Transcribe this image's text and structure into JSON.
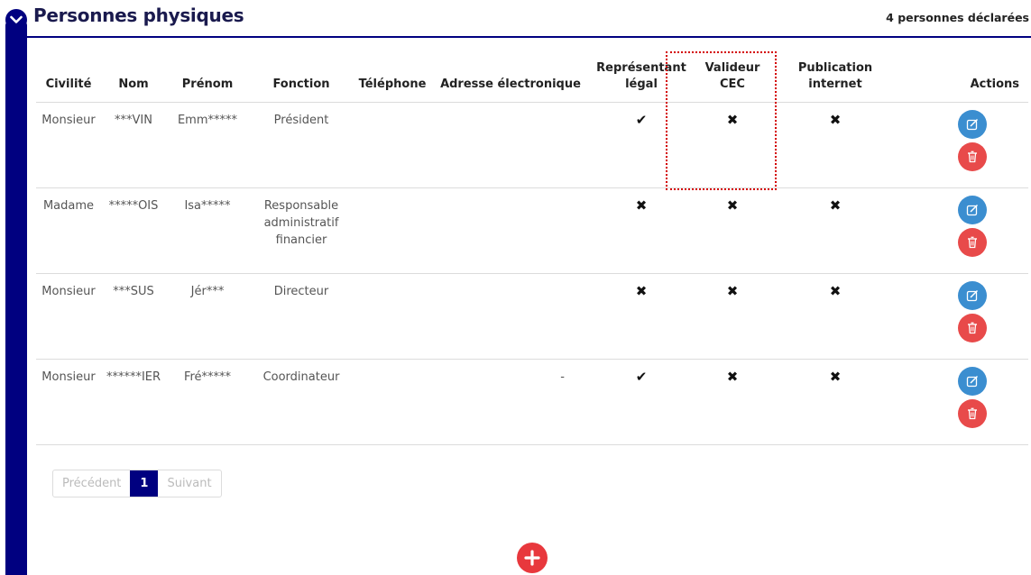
{
  "section": {
    "title": "Personnes physiques",
    "count": "4 personnes déclarées"
  },
  "table": {
    "headers": {
      "civilite": "Civilité",
      "nom": "Nom",
      "prenom": "Prénom",
      "fonction": "Fonction",
      "telephone": "Téléphone",
      "email": "Adresse électronique",
      "representant_1": "Représentant",
      "representant_2": "légal",
      "valideur_1": "Valideur",
      "valideur_2": "CEC",
      "publication_1": "Publication",
      "publication_2": "internet",
      "actions": "Actions"
    },
    "rows": [
      {
        "civilite": "Monsieur",
        "nom": "***VIN",
        "prenom": "Emm*****",
        "fonction": [
          "Président"
        ],
        "telephone": "",
        "email": "",
        "representant": "✔",
        "valideur": "✖",
        "publication": "✖"
      },
      {
        "civilite": "Madame",
        "nom": "*****OIS",
        "prenom": "Isa*****",
        "fonction": [
          "Responsable",
          "administratif",
          "financier"
        ],
        "telephone": "",
        "email": "",
        "representant": "✖",
        "valideur": "✖",
        "publication": "✖"
      },
      {
        "civilite": "Monsieur",
        "nom": "***SUS",
        "prenom": "Jér***",
        "fonction": [
          "Directeur"
        ],
        "telephone": "",
        "email": "",
        "representant": "✖",
        "valideur": "✖",
        "publication": "✖"
      },
      {
        "civilite": "Monsieur",
        "nom": "******IER",
        "prenom": "Fré*****",
        "fonction": [
          "Coordinateur"
        ],
        "telephone": "",
        "email": "-",
        "representant": "✔",
        "valideur": "✖",
        "publication": "✖"
      }
    ]
  },
  "pagination": {
    "previous": "Précédent",
    "current": "1",
    "next": "Suivant"
  },
  "icons": {
    "toggle": "chevron-down-icon",
    "edit": "edit-icon",
    "delete": "trash-icon",
    "add": "plus-icon"
  },
  "colors": {
    "navy": "#000080",
    "edit": "#3b8ed0",
    "delete": "#e84a4a",
    "add": "#e8383d",
    "highlight": "#d40000"
  }
}
